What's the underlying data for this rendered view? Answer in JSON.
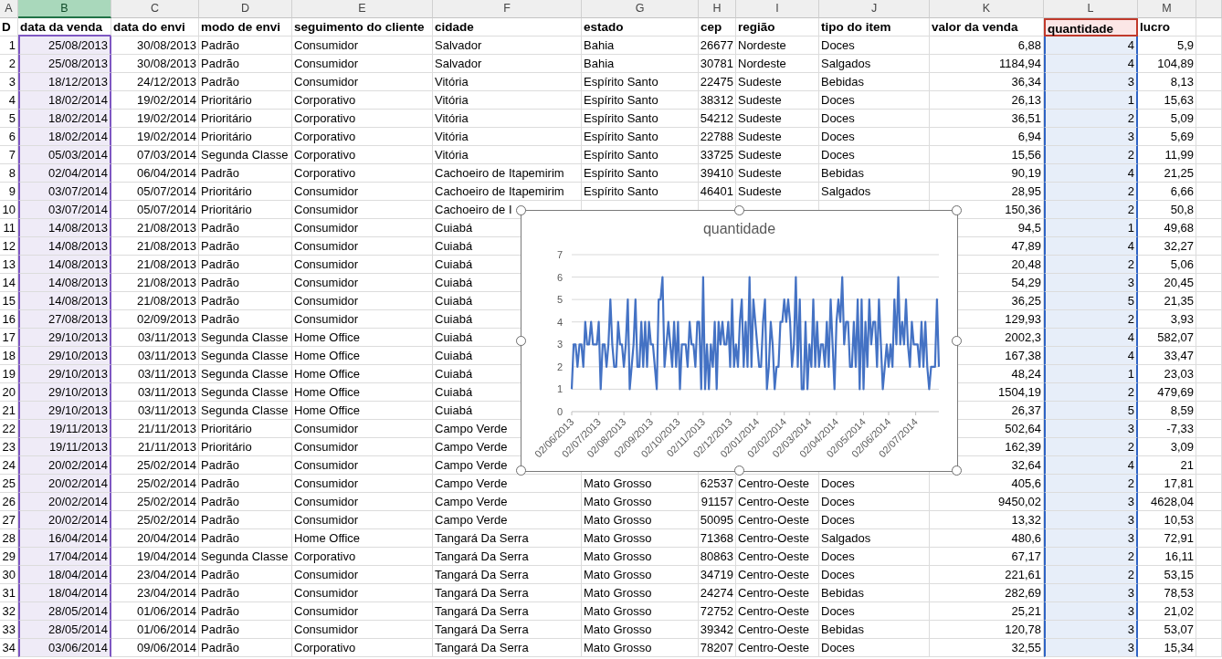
{
  "columns": [
    {
      "letter": "A",
      "title": "D",
      "selected": false,
      "kind": "plain"
    },
    {
      "letter": "B",
      "title": "data da venda",
      "selected": true,
      "kind": "category"
    },
    {
      "letter": "C",
      "title": "data do envi",
      "selected": false,
      "kind": "plain"
    },
    {
      "letter": "D",
      "title": "modo de envi",
      "selected": false,
      "kind": "plain"
    },
    {
      "letter": "E",
      "title": "seguimento do cliente",
      "selected": false,
      "kind": "plain"
    },
    {
      "letter": "F",
      "title": "cidade",
      "selected": false,
      "kind": "plain"
    },
    {
      "letter": "G",
      "title": "estado",
      "selected": false,
      "kind": "plain"
    },
    {
      "letter": "H",
      "title": "cep",
      "selected": false,
      "kind": "plain"
    },
    {
      "letter": "I",
      "title": "região",
      "selected": false,
      "kind": "plain"
    },
    {
      "letter": "J",
      "title": "tipo do item",
      "selected": false,
      "kind": "plain"
    },
    {
      "letter": "K",
      "title": "valor da venda",
      "selected": false,
      "kind": "plain"
    },
    {
      "letter": "L",
      "title": "quantidade",
      "selected": false,
      "kind": "values"
    },
    {
      "letter": "M",
      "title": "lucro",
      "selected": false,
      "kind": "plain"
    }
  ],
  "rows": [
    {
      "cells": [
        "1",
        "25/08/2013",
        "30/08/2013",
        "Padrão",
        "Consumidor",
        "Salvador",
        "Bahia",
        "26677",
        "Nordeste",
        "Doces",
        "6,88",
        "4",
        "5,9"
      ]
    },
    {
      "cells": [
        "2",
        "25/08/2013",
        "30/08/2013",
        "Padrão",
        "Consumidor",
        "Salvador",
        "Bahia",
        "30781",
        "Nordeste",
        "Salgados",
        "1184,94",
        "4",
        "104,89"
      ]
    },
    {
      "cells": [
        "3",
        "18/12/2013",
        "24/12/2013",
        "Padrão",
        "Consumidor",
        "Vitória",
        "Espírito Santo",
        "22475",
        "Sudeste",
        "Bebidas",
        "36,34",
        "3",
        "8,13"
      ]
    },
    {
      "cells": [
        "4",
        "18/02/2014",
        "19/02/2014",
        "Prioritário",
        "Corporativo",
        "Vitória",
        "Espírito Santo",
        "38312",
        "Sudeste",
        "Doces",
        "26,13",
        "1",
        "15,63"
      ]
    },
    {
      "cells": [
        "5",
        "18/02/2014",
        "19/02/2014",
        "Prioritário",
        "Corporativo",
        "Vitória",
        "Espírito Santo",
        "54212",
        "Sudeste",
        "Doces",
        "36,51",
        "2",
        "5,09"
      ]
    },
    {
      "cells": [
        "6",
        "18/02/2014",
        "19/02/2014",
        "Prioritário",
        "Corporativo",
        "Vitória",
        "Espírito Santo",
        "22788",
        "Sudeste",
        "Doces",
        "6,94",
        "3",
        "5,69"
      ]
    },
    {
      "cells": [
        "7",
        "05/03/2014",
        "07/03/2014",
        "Segunda Classe",
        "Corporativo",
        "Vitória",
        "Espírito Santo",
        "33725",
        "Sudeste",
        "Doces",
        "15,56",
        "2",
        "11,99"
      ]
    },
    {
      "cells": [
        "8",
        "02/04/2014",
        "06/04/2014",
        "Padrão",
        "Corporativo",
        "Cachoeiro de Itapemirim",
        "Espírito Santo",
        "39410",
        "Sudeste",
        "Bebidas",
        "90,19",
        "4",
        "21,25"
      ]
    },
    {
      "cells": [
        "9",
        "03/07/2014",
        "05/07/2014",
        "Prioritário",
        "Consumidor",
        "Cachoeiro de Itapemirim",
        "Espírito Santo",
        "46401",
        "Sudeste",
        "Salgados",
        "28,95",
        "2",
        "6,66"
      ]
    },
    {
      "cells": [
        "10",
        "03/07/2014",
        "05/07/2014",
        "Prioritário",
        "Consumidor",
        "Cachoeiro de I",
        "150,36",
        "2",
        "50,8"
      ]
    },
    {
      "cells": [
        "11",
        "14/08/2013",
        "21/08/2013",
        "Padrão",
        "Consumidor",
        "Cuiabá",
        "94,5",
        "1",
        "49,68"
      ]
    },
    {
      "cells": [
        "12",
        "14/08/2013",
        "21/08/2013",
        "Padrão",
        "Consumidor",
        "Cuiabá",
        "47,89",
        "4",
        "32,27"
      ]
    },
    {
      "cells": [
        "13",
        "14/08/2013",
        "21/08/2013",
        "Padrão",
        "Consumidor",
        "Cuiabá",
        "20,48",
        "2",
        "5,06"
      ]
    },
    {
      "cells": [
        "14",
        "14/08/2013",
        "21/08/2013",
        "Padrão",
        "Consumidor",
        "Cuiabá",
        "54,29",
        "3",
        "20,45"
      ]
    },
    {
      "cells": [
        "15",
        "14/08/2013",
        "21/08/2013",
        "Padrão",
        "Consumidor",
        "Cuiabá",
        "36,25",
        "5",
        "21,35"
      ]
    },
    {
      "cells": [
        "16",
        "27/08/2013",
        "02/09/2013",
        "Padrão",
        "Consumidor",
        "Cuiabá",
        "129,93",
        "2",
        "3,93"
      ]
    },
    {
      "cells": [
        "17",
        "29/10/2013",
        "03/11/2013",
        "Segunda Classe",
        "Home Office",
        "Cuiabá",
        "2002,3",
        "4",
        "582,07"
      ]
    },
    {
      "cells": [
        "18",
        "29/10/2013",
        "03/11/2013",
        "Segunda Classe",
        "Home Office",
        "Cuiabá",
        "167,38",
        "4",
        "33,47"
      ]
    },
    {
      "cells": [
        "19",
        "29/10/2013",
        "03/11/2013",
        "Segunda Classe",
        "Home Office",
        "Cuiabá",
        "48,24",
        "1",
        "23,03"
      ]
    },
    {
      "cells": [
        "20",
        "29/10/2013",
        "03/11/2013",
        "Segunda Classe",
        "Home Office",
        "Cuiabá",
        "1504,19",
        "2",
        "479,69"
      ]
    },
    {
      "cells": [
        "21",
        "29/10/2013",
        "03/11/2013",
        "Segunda Classe",
        "Home Office",
        "Cuiabá",
        "26,37",
        "5",
        "8,59"
      ]
    },
    {
      "cells": [
        "22",
        "19/11/2013",
        "21/11/2013",
        "Prioritário",
        "Consumidor",
        "Campo Verde",
        "502,64",
        "3",
        "-7,33"
      ]
    },
    {
      "cells": [
        "23",
        "19/11/2013",
        "21/11/2013",
        "Prioritário",
        "Consumidor",
        "Campo Verde",
        "162,39",
        "2",
        "3,09"
      ]
    },
    {
      "cells": [
        "24",
        "20/02/2014",
        "25/02/2014",
        "Padrão",
        "Consumidor",
        "Campo Verde",
        "32,64",
        "4",
        "21"
      ]
    },
    {
      "cells": [
        "25",
        "20/02/2014",
        "25/02/2014",
        "Padrão",
        "Consumidor",
        "Campo Verde",
        "Mato Grosso",
        "62537",
        "Centro-Oeste",
        "Doces",
        "405,6",
        "2",
        "17,81"
      ]
    },
    {
      "cells": [
        "26",
        "20/02/2014",
        "25/02/2014",
        "Padrão",
        "Consumidor",
        "Campo Verde",
        "Mato Grosso",
        "91157",
        "Centro-Oeste",
        "Doces",
        "9450,02",
        "3",
        "4628,04"
      ]
    },
    {
      "cells": [
        "27",
        "20/02/2014",
        "25/02/2014",
        "Padrão",
        "Consumidor",
        "Campo Verde",
        "Mato Grosso",
        "50095",
        "Centro-Oeste",
        "Doces",
        "13,32",
        "3",
        "10,53"
      ]
    },
    {
      "cells": [
        "28",
        "16/04/2014",
        "20/04/2014",
        "Padrão",
        "Home Office",
        "Tangará Da Serra",
        "Mato Grosso",
        "71368",
        "Centro-Oeste",
        "Salgados",
        "480,6",
        "3",
        "72,91"
      ]
    },
    {
      "cells": [
        "29",
        "17/04/2014",
        "19/04/2014",
        "Segunda Classe",
        "Corporativo",
        "Tangará Da Serra",
        "Mato Grosso",
        "80863",
        "Centro-Oeste",
        "Doces",
        "67,17",
        "2",
        "16,11"
      ]
    },
    {
      "cells": [
        "30",
        "18/04/2014",
        "23/04/2014",
        "Padrão",
        "Consumidor",
        "Tangará Da Serra",
        "Mato Grosso",
        "34719",
        "Centro-Oeste",
        "Doces",
        "221,61",
        "2",
        "53,15"
      ]
    },
    {
      "cells": [
        "31",
        "18/04/2014",
        "23/04/2014",
        "Padrão",
        "Consumidor",
        "Tangará Da Serra",
        "Mato Grosso",
        "24274",
        "Centro-Oeste",
        "Bebidas",
        "282,69",
        "3",
        "78,53"
      ]
    },
    {
      "cells": [
        "32",
        "28/05/2014",
        "01/06/2014",
        "Padrão",
        "Consumidor",
        "Tangará Da Serra",
        "Mato Grosso",
        "72752",
        "Centro-Oeste",
        "Doces",
        "25,21",
        "3",
        "21,02"
      ]
    },
    {
      "cells": [
        "33",
        "28/05/2014",
        "01/06/2014",
        "Padrão",
        "Consumidor",
        "Tangará Da Serra",
        "Mato Grosso",
        "39342",
        "Centro-Oeste",
        "Bebidas",
        "120,78",
        "3",
        "53,07"
      ]
    },
    {
      "cells": [
        "34",
        "03/06/2014",
        "09/06/2014",
        "Padrão",
        "Corporativo",
        "Tangará Da Serra",
        "Mato Grosso",
        "78207",
        "Centro-Oeste",
        "Doces",
        "32,55",
        "3",
        "15,34"
      ]
    }
  ],
  "chart": {
    "selected": true,
    "chart_data": {
      "type": "line",
      "title": "quantidade",
      "grid": true,
      "ylim": [
        0,
        7
      ],
      "yticks": [
        {
          "value": 0,
          "label": "0"
        },
        {
          "value": 1,
          "label": "1"
        },
        {
          "value": 2,
          "label": "2"
        },
        {
          "value": 3,
          "label": "3"
        },
        {
          "value": 4,
          "label": "4"
        },
        {
          "value": 5,
          "label": "5"
        },
        {
          "value": 6,
          "label": "6"
        },
        {
          "value": 7,
          "label": "7"
        }
      ],
      "categories": [
        "02/06/2013",
        null,
        null,
        null,
        null,
        null,
        null,
        null,
        null,
        null,
        null,
        null,
        null,
        null,
        "02/07/2013",
        null,
        null,
        null,
        null,
        null,
        null,
        null,
        null,
        null,
        null,
        null,
        null,
        "02/08/2013",
        null,
        null,
        null,
        null,
        null,
        null,
        null,
        null,
        null,
        null,
        null,
        null,
        null,
        "02/09/2013",
        null,
        null,
        null,
        null,
        null,
        null,
        null,
        null,
        null,
        null,
        null,
        null,
        null,
        "02/10/2013",
        null,
        null,
        null,
        null,
        null,
        null,
        null,
        null,
        null,
        null,
        null,
        null,
        "02/11/2013",
        null,
        null,
        null,
        null,
        null,
        null,
        null,
        null,
        null,
        null,
        null,
        null,
        null,
        "02/12/2013",
        null,
        null,
        null,
        null,
        null,
        null,
        null,
        null,
        null,
        null,
        null,
        null,
        null,
        "02/01/2014",
        null,
        null,
        null,
        null,
        null,
        null,
        null,
        null,
        null,
        null,
        null,
        null,
        null,
        "02/02/2014",
        null,
        null,
        null,
        null,
        null,
        null,
        null,
        null,
        null,
        null,
        null,
        null,
        "02/03/2014",
        null,
        null,
        null,
        null,
        null,
        null,
        null,
        null,
        null,
        null,
        null,
        null,
        null,
        "02/04/2014",
        null,
        null,
        null,
        null,
        null,
        null,
        null,
        null,
        null,
        null,
        null,
        null,
        null,
        "02/05/2014",
        null,
        null,
        null,
        null,
        null,
        null,
        null,
        null,
        null,
        null,
        null,
        null,
        "02/06/2014",
        null,
        null,
        null,
        null,
        null,
        null,
        null,
        null,
        null,
        null,
        null,
        null,
        null,
        "02/07/2014",
        null,
        null,
        null,
        null,
        null,
        null,
        null,
        null,
        null,
        null,
        null,
        null
      ],
      "series": [
        {
          "color": "#4472c4",
          "values": [
            1,
            3,
            3,
            2,
            3,
            3,
            2,
            4,
            3,
            3,
            4,
            3,
            3,
            3,
            4,
            1,
            3,
            3,
            2,
            3,
            5,
            3,
            2,
            2,
            4,
            3,
            3,
            2,
            3,
            5,
            1,
            2,
            3,
            5,
            2,
            2,
            4,
            2,
            4,
            2,
            4,
            3,
            3,
            2,
            1,
            5,
            5,
            6,
            2,
            3,
            4,
            3,
            2,
            4,
            2,
            4,
            1,
            3,
            3,
            3,
            2,
            4,
            3,
            3,
            2,
            4,
            4,
            1,
            6,
            1,
            3,
            1,
            3,
            2,
            4,
            1,
            4,
            3,
            4,
            3,
            3,
            4,
            2,
            5,
            2,
            3,
            2,
            4,
            5,
            2,
            4,
            2,
            6,
            2,
            5,
            4,
            3,
            2,
            2,
            4,
            5,
            1,
            2,
            4,
            3,
            1,
            2,
            2,
            4,
            4,
            5,
            4,
            5,
            4,
            2,
            3,
            6,
            2,
            5,
            1,
            1,
            4,
            1,
            3,
            2,
            5,
            2,
            4,
            2,
            3,
            3,
            2,
            4,
            2,
            5,
            3,
            1,
            4,
            5,
            4,
            6,
            3,
            4,
            4,
            2,
            2,
            4,
            2,
            5,
            1,
            5,
            1,
            4,
            2,
            5,
            3,
            4,
            4,
            2,
            5,
            3,
            1,
            2,
            3,
            2,
            3,
            2,
            5,
            3,
            6,
            3,
            4,
            3,
            5,
            3,
            2,
            4,
            3,
            3,
            3,
            2,
            4,
            2,
            4,
            2,
            1,
            2,
            2,
            2,
            5,
            2
          ]
        }
      ]
    }
  }
}
